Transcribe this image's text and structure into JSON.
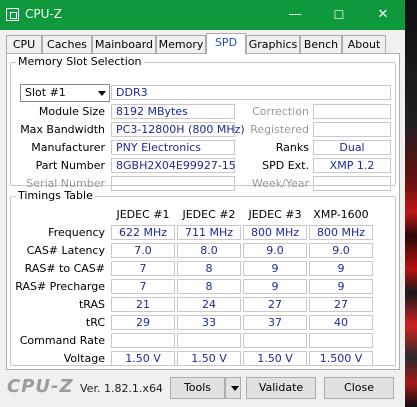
{
  "window": {
    "title": "CPU-Z",
    "min": "—",
    "max": "☐",
    "close": "✕"
  },
  "tabs": [
    "CPU",
    "Caches",
    "Mainboard",
    "Memory",
    "SPD",
    "Graphics",
    "Bench",
    "About"
  ],
  "active_tab": "SPD",
  "slot_group": {
    "title": "Memory Slot Selection",
    "slot_select": "Slot #1",
    "type": "DDR3",
    "module_size_label": "Module Size",
    "module_size": "8192 MBytes",
    "max_bandwidth_label": "Max Bandwidth",
    "max_bandwidth": "PC3-12800H (800 MHz)",
    "manufacturer_label": "Manufacturer",
    "manufacturer": "PNY Electronics",
    "part_number_label": "Part Number",
    "part_number": "8GBH2X04E99927-15",
    "serial_number_label": "Serial Number",
    "serial_number": "",
    "correction_label": "Correction",
    "correction": "",
    "registered_label": "Registered",
    "registered": "",
    "ranks_label": "Ranks",
    "ranks": "Dual",
    "spd_ext_label": "SPD Ext.",
    "spd_ext": "XMP 1.2",
    "week_year_label": "Week/Year",
    "week_year": ""
  },
  "timings": {
    "title": "Timings Table",
    "columns": [
      "JEDEC #1",
      "JEDEC #2",
      "JEDEC #3",
      "XMP-1600"
    ],
    "rows": [
      {
        "label": "Frequency",
        "values": [
          "622 MHz",
          "711 MHz",
          "800 MHz",
          "800 MHz"
        ]
      },
      {
        "label": "CAS# Latency",
        "values": [
          "7.0",
          "8.0",
          "9.0",
          "9.0"
        ]
      },
      {
        "label": "RAS# to CAS#",
        "values": [
          "7",
          "8",
          "9",
          "9"
        ]
      },
      {
        "label": "RAS# Precharge",
        "values": [
          "7",
          "8",
          "9",
          "9"
        ]
      },
      {
        "label": "tRAS",
        "values": [
          "21",
          "24",
          "27",
          "27"
        ]
      },
      {
        "label": "tRC",
        "values": [
          "29",
          "33",
          "37",
          "40"
        ]
      },
      {
        "label": "Command Rate",
        "values": [
          "",
          "",
          "",
          ""
        ]
      },
      {
        "label": "Voltage",
        "values": [
          "1.50 V",
          "1.50 V",
          "1.50 V",
          "1.500 V"
        ]
      }
    ]
  },
  "footer": {
    "logo": "CPU-Z",
    "version": "Ver. 1.82.1.x64",
    "tools": "Tools",
    "validate": "Validate",
    "close": "Close"
  },
  "colors": {
    "titlebar": "#0e9a3c",
    "value_text": "#1c2a9a",
    "active_tab_text": "#1a4fc4"
  }
}
